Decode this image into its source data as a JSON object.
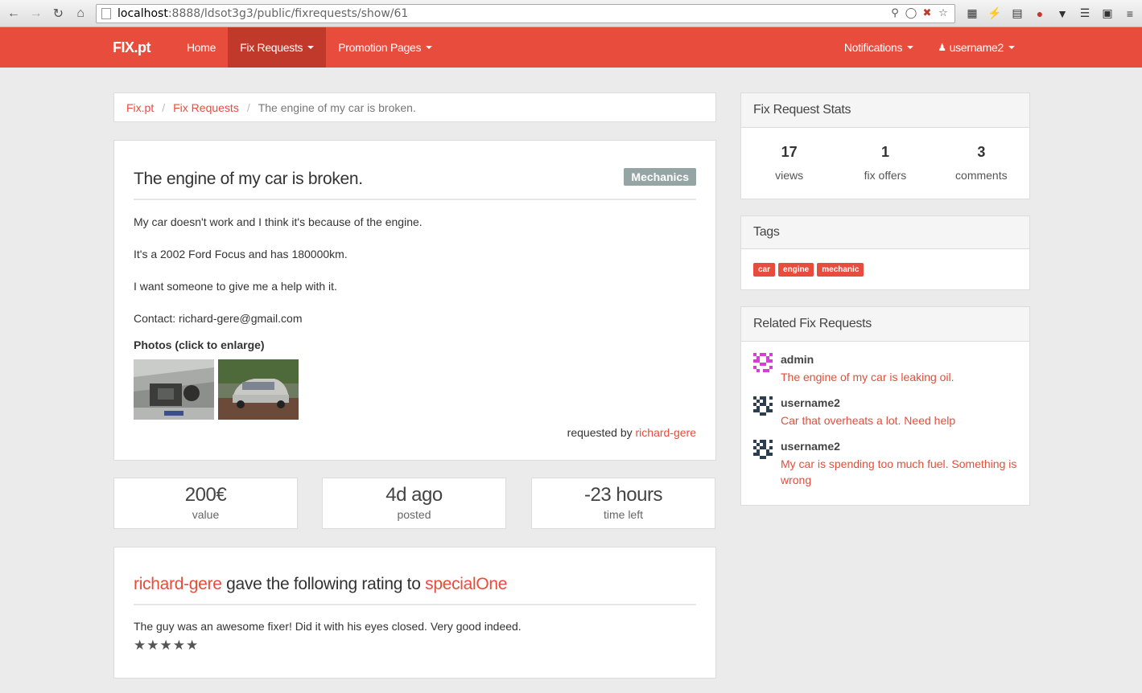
{
  "browser": {
    "url_host": "localhost",
    "url_path": ":8888/ldsot3g3/public/fixrequests/show/61"
  },
  "navbar": {
    "brand": "FIX.pt",
    "items": [
      {
        "label": "Home"
      },
      {
        "label": "Fix Requests"
      },
      {
        "label": "Promotion Pages"
      }
    ],
    "notifications_label": "Notifications",
    "user_label": "username2",
    "accent_color": "#e74c3c"
  },
  "breadcrumb": {
    "root": "Fix.pt",
    "section": "Fix Requests",
    "current": "The engine of my car is broken."
  },
  "request": {
    "title": "The engine of my car is broken.",
    "category": "Mechanics",
    "description": [
      "My car doesn't work and I think it's because of the engine.",
      "It's a 2002 Ford Focus and has 180000km.",
      "I want someone to give me a help with it.",
      "Contact: richard-gere@gmail.com"
    ],
    "photos_label": "Photos (click to enlarge)",
    "requested_by_prefix": "requested by",
    "requester": "richard-gere"
  },
  "stats_boxes": [
    {
      "value": "200€",
      "label": "value"
    },
    {
      "value": "4d ago",
      "label": "posted"
    },
    {
      "value": "-23 hours",
      "label": "time left"
    }
  ],
  "rating": {
    "rater": "richard-gere",
    "middle_text": " gave the following rating to ",
    "fixer": "specialOne",
    "comment": "The guy was an awesome fixer! Did it with his eyes closed. Very good indeed.",
    "stars_text": "★★★★★"
  },
  "sidebar": {
    "stats": {
      "title": "Fix Request Stats",
      "items": [
        {
          "num": "17",
          "label": "views"
        },
        {
          "num": "1",
          "label": "fix offers"
        },
        {
          "num": "3",
          "label": "comments"
        }
      ]
    },
    "tags": {
      "title": "Tags",
      "items": [
        "car",
        "engine",
        "mechanic"
      ]
    },
    "related": {
      "title": "Related Fix Requests",
      "items": [
        {
          "author": "admin",
          "title": "The engine of my car is leaking oil."
        },
        {
          "author": "username2",
          "title": "Car that overheats a lot. Need help"
        },
        {
          "author": "username2",
          "title": "My car is spending too much fuel. Something is wrong"
        }
      ]
    }
  }
}
